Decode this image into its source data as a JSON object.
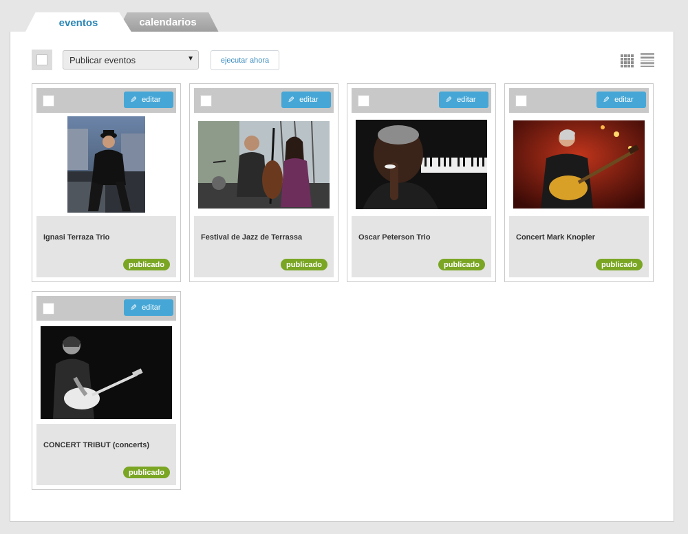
{
  "tabs": [
    {
      "label": "eventos",
      "active": true
    },
    {
      "label": "calendarios",
      "active": false
    }
  ],
  "toolbar": {
    "bulk_action": "Publicar eventos",
    "run_label": "ejecutar ahora",
    "views": [
      "grid-view-icon",
      "list-view-icon"
    ]
  },
  "events": [
    {
      "title": "Ignasi Terraza Trio",
      "status": "publicado",
      "edit_label": "editar",
      "image": "man-in-hat-photo"
    },
    {
      "title": "Festival de Jazz de Terrassa",
      "status": "publicado",
      "edit_label": "editar",
      "image": "jazz-band-photo"
    },
    {
      "title": "Oscar Peterson Trio",
      "status": "publicado",
      "edit_label": "editar",
      "image": "pianist-photo"
    },
    {
      "title": "Concert Mark Knopler",
      "status": "publicado",
      "edit_label": "editar",
      "image": "guitarist-red-photo"
    },
    {
      "title": "CONCERT TRIBUT (concerts)",
      "status": "publicado",
      "edit_label": "editar",
      "image": "guitarist-bw-photo"
    }
  ],
  "colors": {
    "accent_blue": "#46a7d6",
    "tab_active_text": "#2a86b6",
    "published_green": "#7aa624"
  }
}
